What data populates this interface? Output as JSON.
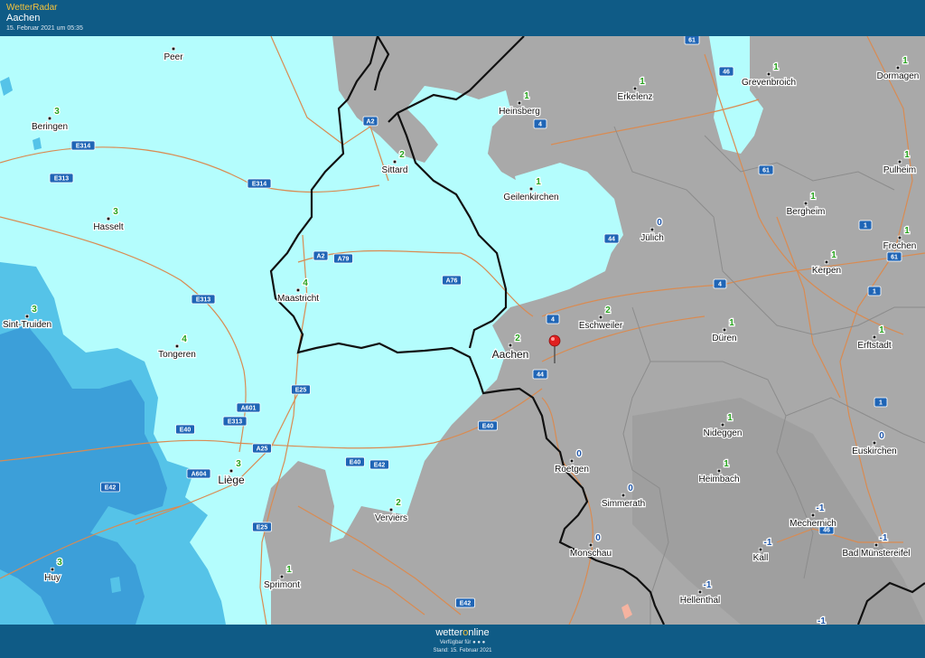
{
  "header": {
    "app_title": "WetterRadar",
    "location": "Aachen",
    "date": "15. Februar 2021 um 05:35"
  },
  "footer": {
    "brand_prefix": "wetter",
    "brand_o": "o",
    "brand_suffix": "nline",
    "available": "Verfügbar für ● ● ●",
    "stand": "Stand: 15. Februar 2021"
  },
  "colors": {
    "snow_light": "#b4fdfd",
    "snow_medium": "#55c3e8",
    "snow_heavy": "#3c9fd9",
    "dry": "#a9a9a9",
    "border": "#111111",
    "road": "#d98b52",
    "positive_value": "#27a21d",
    "negative_value": "#1f56a8",
    "pin": "#e02020"
  },
  "cities": [
    {
      "name": "Peer",
      "value": ""
    },
    {
      "name": "Beringen",
      "value": "3"
    },
    {
      "name": "Hasselt",
      "value": "3"
    },
    {
      "name": "Sint-Truiden",
      "value": "3"
    },
    {
      "name": "Tongeren",
      "value": "4"
    },
    {
      "name": "Maastricht",
      "value": "4"
    },
    {
      "name": "Sittard",
      "value": "2"
    },
    {
      "name": "Heinsberg",
      "value": "1"
    },
    {
      "name": "Erkelenz",
      "value": "1"
    },
    {
      "name": "Grevenbroich",
      "value": "1"
    },
    {
      "name": "Dormagen",
      "value": "1"
    },
    {
      "name": "Pulheim",
      "value": "1"
    },
    {
      "name": "Geilenkirchen",
      "value": "1"
    },
    {
      "name": "Bergheim",
      "value": "1"
    },
    {
      "name": "Jülich",
      "value": "0"
    },
    {
      "name": "Frechen",
      "value": "1"
    },
    {
      "name": "Kerpen",
      "value": "1"
    },
    {
      "name": "Erftstadt",
      "value": "1"
    },
    {
      "name": "Aachen",
      "value": "2"
    },
    {
      "name": "Eschweiler",
      "value": "2"
    },
    {
      "name": "Düren",
      "value": "1"
    },
    {
      "name": "Liège",
      "value": "3"
    },
    {
      "name": "Verviers",
      "value": "2"
    },
    {
      "name": "Roetgen",
      "value": "0"
    },
    {
      "name": "Nideggen",
      "value": "1"
    },
    {
      "name": "Heimbach",
      "value": "1"
    },
    {
      "name": "Euskirchen",
      "value": "0"
    },
    {
      "name": "Simmerath",
      "value": "0"
    },
    {
      "name": "Mechernich",
      "value": "-1"
    },
    {
      "name": "Monschau",
      "value": "0"
    },
    {
      "name": "Kall",
      "value": "-1"
    },
    {
      "name": "Bad Münstereifel",
      "value": "-1"
    },
    {
      "name": "Huy",
      "value": "3"
    },
    {
      "name": "Sprimont",
      "value": "1"
    },
    {
      "name": "Hellenthal",
      "value": "-1"
    }
  ],
  "roads": [
    "A2",
    "E314",
    "E313",
    "E314",
    "A2",
    "A79",
    "A76",
    "E313",
    "A601",
    "E313",
    "E25",
    "E40",
    "A25",
    "A604",
    "E42",
    "E40",
    "E42",
    "E25",
    "E40",
    "44",
    "4",
    "44",
    "46",
    "61",
    "4",
    "4",
    "1",
    "61",
    "1",
    "1",
    "E42",
    "61",
    "46"
  ],
  "extra_value": "-1"
}
